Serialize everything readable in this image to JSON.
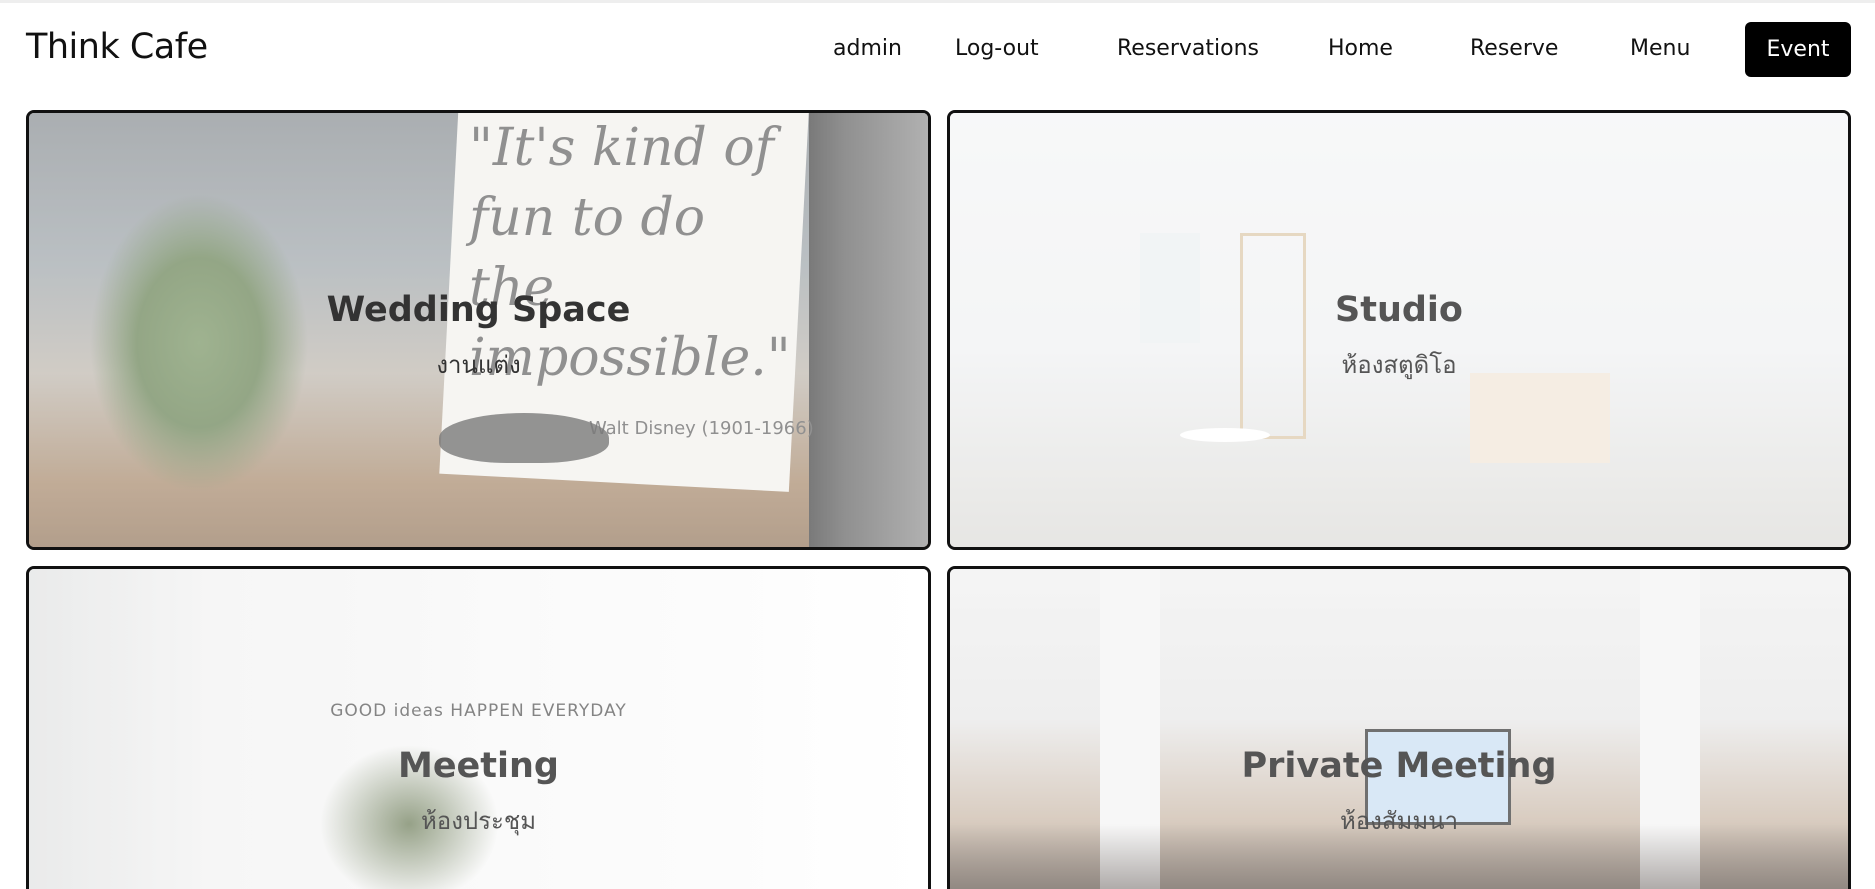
{
  "app": {
    "brand": "Think Cafe"
  },
  "nav": {
    "items": [
      {
        "label": "admin"
      },
      {
        "label": "Log-out"
      },
      {
        "label": "Reservations"
      },
      {
        "label": "Home"
      },
      {
        "label": "Reserve"
      },
      {
        "label": "Menu"
      }
    ],
    "active": {
      "label": "Event"
    }
  },
  "cards": [
    {
      "title": "Wedding Space",
      "subtitle": "งานแต่ง",
      "photo_text": {
        "quote": "\"It's kind of fun to do the impossible.\"",
        "attribution": "Walt Disney (1901-1966)"
      }
    },
    {
      "title": "Studio",
      "subtitle": "ห้องสตูดิโอ"
    },
    {
      "title": "Meeting",
      "subtitle": "ห้องประชุม",
      "photo_text": {
        "sign": "GOOD ideas HAPPEN EVERYDAY"
      }
    },
    {
      "title": "Private Meeting",
      "subtitle": "ห้องสัมมนา"
    }
  ],
  "colors": {
    "active_nav_bg": "#000000",
    "active_nav_text": "#ffffff",
    "card_border": "#111111",
    "card_title": "#555555"
  }
}
